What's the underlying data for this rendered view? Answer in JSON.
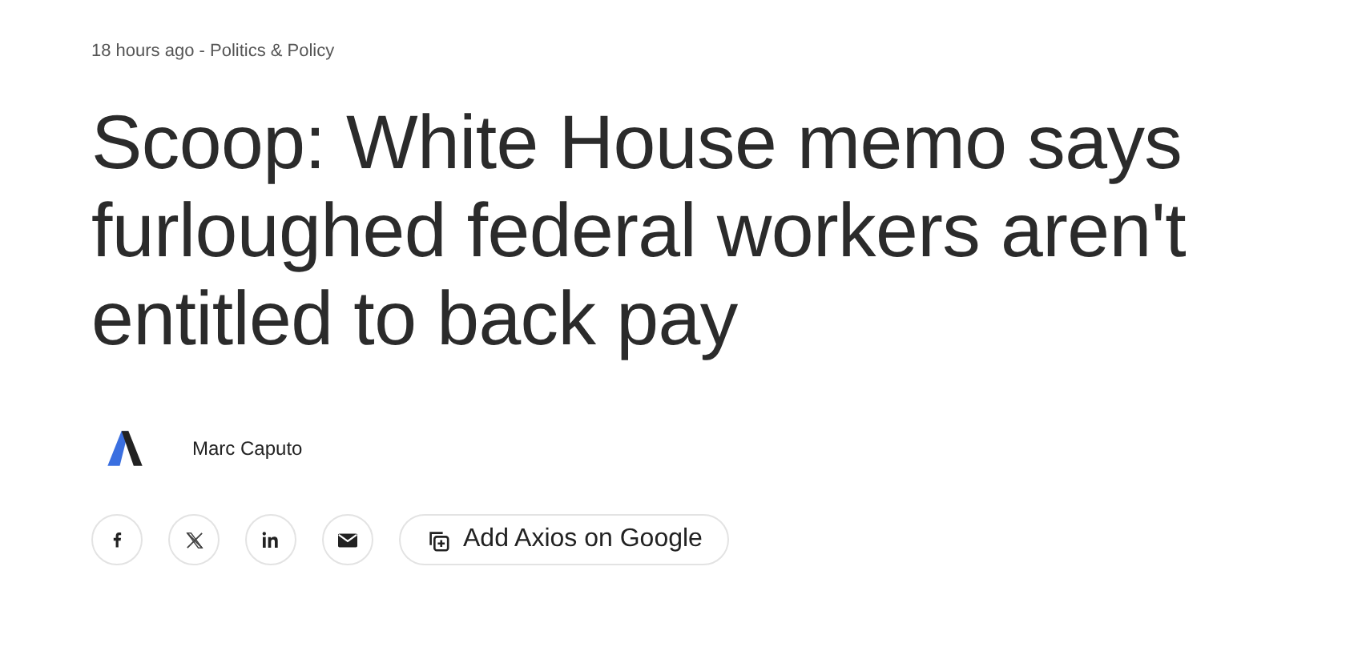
{
  "meta": {
    "time": "18 hours ago",
    "separator": "-",
    "section": "Politics & Policy"
  },
  "headline": "Scoop: White House memo says furloughed federal workers aren't entitled to back pay",
  "author": {
    "name": "Marc Caputo"
  },
  "share": [
    {
      "kind": "facebook"
    },
    {
      "kind": "x"
    },
    {
      "kind": "linkedin"
    },
    {
      "kind": "email"
    }
  ],
  "google_button": {
    "label": "Add Axios on Google"
  }
}
